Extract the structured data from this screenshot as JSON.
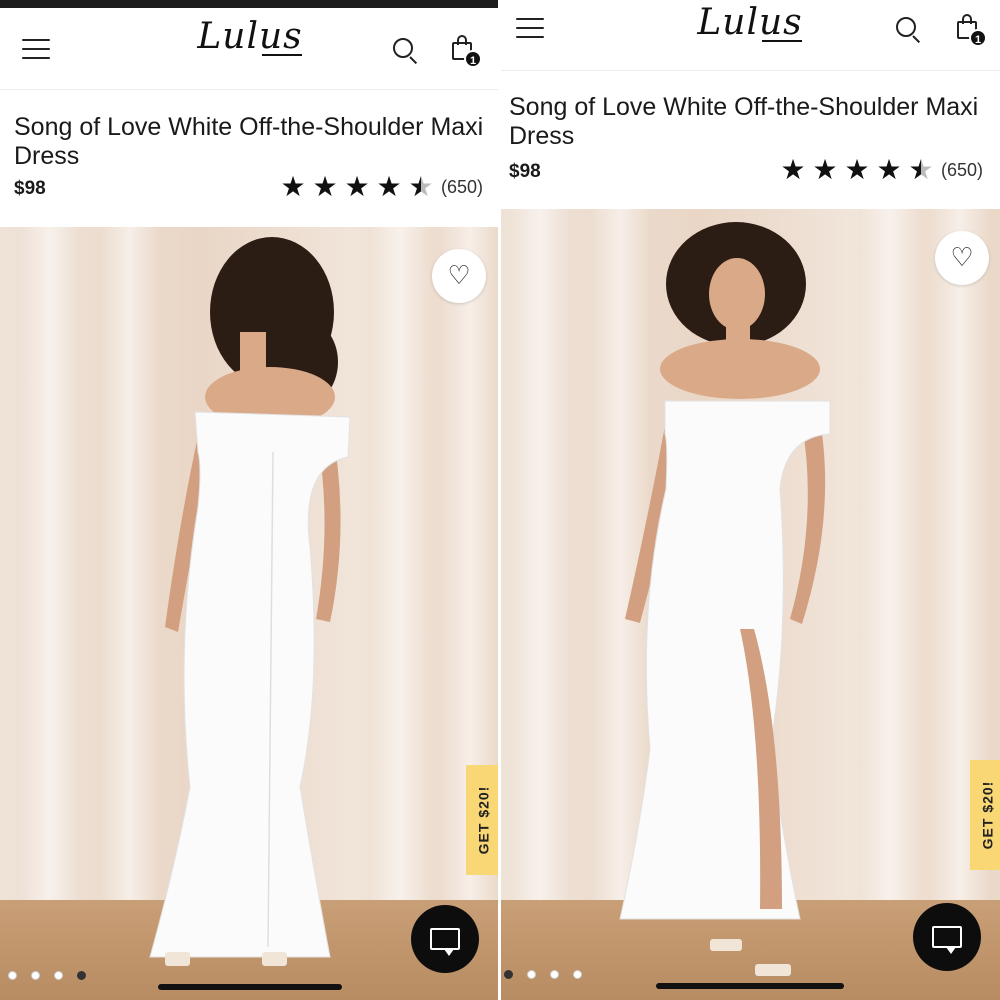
{
  "screens": [
    {
      "brand": "Lulus",
      "cart_count": "1",
      "product_title": "Song of Love White Off-the-Shoulder Maxi Dress",
      "price": "$98",
      "rating": 4.5,
      "review_count": "(650)",
      "promo_label": "GET $20!",
      "carousel": {
        "total": 4,
        "active_index": 4
      },
      "view": "back"
    },
    {
      "brand": "Lulus",
      "cart_count": "1",
      "product_title": "Song of Love White Off-the-Shoulder Maxi Dress",
      "price": "$98",
      "rating": 4.5,
      "review_count": "(650)",
      "promo_label": "GET $20!",
      "carousel": {
        "total": 4,
        "active_index": 1
      },
      "view": "front"
    }
  ],
  "icons": {
    "menu": "hamburger-menu-icon",
    "search": "search-icon",
    "bag": "shopping-bag-icon",
    "favorite": "heart-icon",
    "chat": "chat-icon",
    "star_full": "★",
    "star_half": "★",
    "heart_glyph": "♡"
  },
  "colors": {
    "header_bg": "#ffffff",
    "text": "#1a1a1a",
    "promo_bg": "#f8d774",
    "chat_bg": "#0d0d0d",
    "wall": "#ead8c8",
    "floor": "#b88c62",
    "dress": "#fbfbfb"
  }
}
